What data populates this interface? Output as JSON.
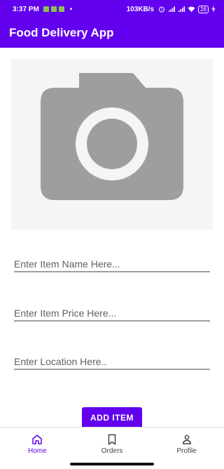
{
  "status_bar": {
    "time": "3:37 PM",
    "dot": "•",
    "speed": "103KB/s",
    "battery": "26"
  },
  "app_bar": {
    "title": "Food Delivery App"
  },
  "image_placeholder": {
    "icon": "camera-icon"
  },
  "form": {
    "item_name_placeholder": "Enter Item Name Here...",
    "item_price_placeholder": "Enter Item Price Here...",
    "location_placeholder": "Enter Location Here.."
  },
  "add_button_label": "ADD ITEM",
  "bottom_nav": {
    "items": [
      {
        "label": "Home",
        "icon": "home-icon"
      },
      {
        "label": "Orders",
        "icon": "bookmark-icon"
      },
      {
        "label": "Profile",
        "icon": "person-icon"
      }
    ]
  },
  "colors": {
    "primary": "#6200ee",
    "placeholder_bg": "#f5f5f5",
    "camera_icon": "#9e9e9e"
  }
}
